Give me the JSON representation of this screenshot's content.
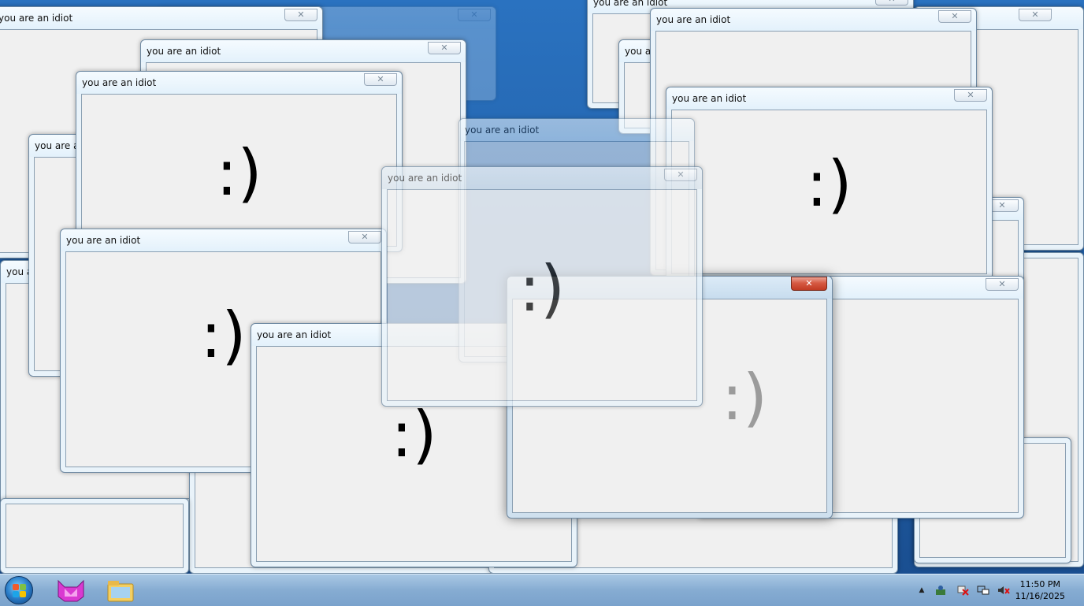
{
  "window_title": "you are an idiot",
  "smiley_text": ":)",
  "close_symbol": "✕",
  "taskbar": {
    "time": "11:50 PM",
    "date": "11/16/2025",
    "tray_up_arrow": "▲",
    "pinned": [
      "start-orb",
      "cat-app",
      "windows-explorer"
    ]
  },
  "colors": {
    "desktop_blue": "#1d5fa8",
    "window_frame": "#e9f3fa",
    "client_bg": "#f0f0f0",
    "active_close": "#c13a22",
    "taskbar": "#86acd2"
  }
}
